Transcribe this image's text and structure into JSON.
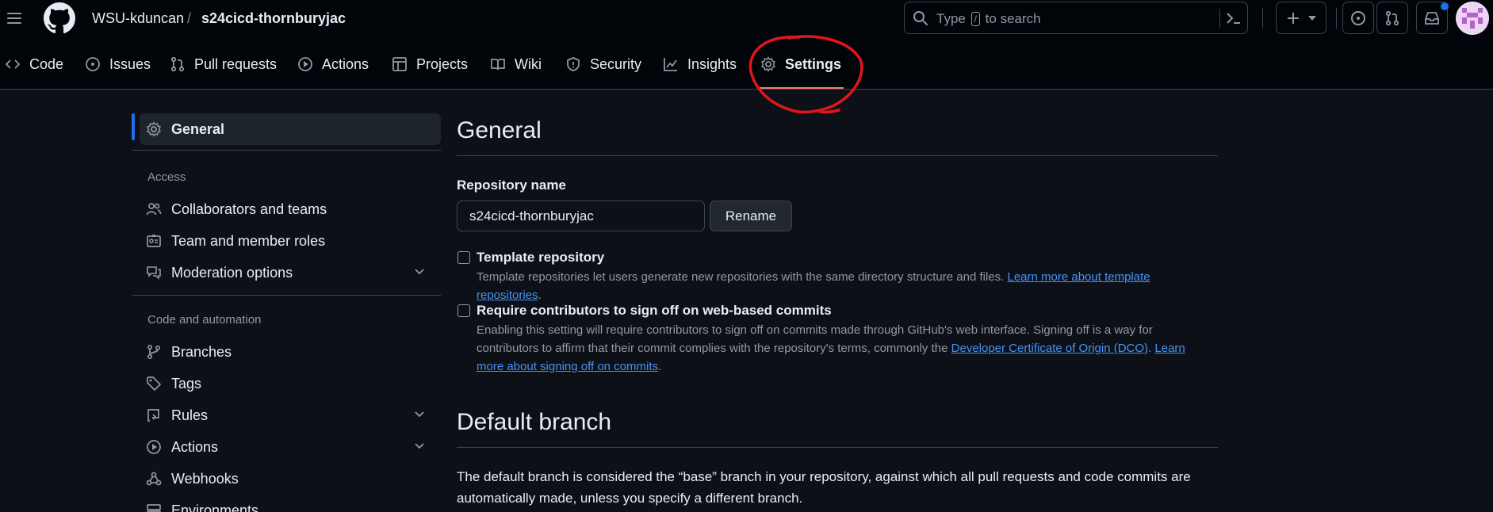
{
  "header": {
    "owner": "WSU-kduncan",
    "separator": "/",
    "repo": "s24cicd-thornburyjac",
    "search_prefix": "Type",
    "search_key": "/",
    "search_suffix": "to search"
  },
  "repo_nav": {
    "tabs": [
      {
        "label": "Code",
        "icon": "code-icon"
      },
      {
        "label": "Issues",
        "icon": "issue-icon"
      },
      {
        "label": "Pull requests",
        "icon": "pull-request-icon"
      },
      {
        "label": "Actions",
        "icon": "play-icon"
      },
      {
        "label": "Projects",
        "icon": "table-icon"
      },
      {
        "label": "Wiki",
        "icon": "book-icon"
      },
      {
        "label": "Security",
        "icon": "shield-icon"
      },
      {
        "label": "Insights",
        "icon": "graph-icon"
      },
      {
        "label": "Settings",
        "icon": "gear-icon",
        "selected": true
      }
    ]
  },
  "sidebar": {
    "general": "General",
    "access_heading": "Access",
    "access_items": [
      {
        "label": "Collaborators and teams",
        "icon": "people-icon"
      },
      {
        "label": "Team and member roles",
        "icon": "id-badge-icon"
      },
      {
        "label": "Moderation options",
        "icon": "comment-discussion-icon",
        "expandable": true
      }
    ],
    "code_heading": "Code and automation",
    "code_items": [
      {
        "label": "Branches",
        "icon": "branch-icon"
      },
      {
        "label": "Tags",
        "icon": "tag-icon"
      },
      {
        "label": "Rules",
        "icon": "repo-push-icon",
        "expandable": true
      },
      {
        "label": "Actions",
        "icon": "play-icon",
        "expandable": true
      },
      {
        "label": "Webhooks",
        "icon": "webhook-icon"
      },
      {
        "label": "Environments",
        "icon": "server-icon"
      }
    ]
  },
  "main": {
    "title": "General",
    "repo_name_label": "Repository name",
    "repo_name_value": "s24cicd-thornburyjac",
    "rename_label": "Rename",
    "template": {
      "label": "Template repository",
      "desc": "Template repositories let users generate new repositories with the same directory structure and files.",
      "link": "Learn more about template repositories",
      "after": "."
    },
    "signoff": {
      "label": "Require contributors to sign off on web-based commits",
      "desc_1": "Enabling this setting will require contributors to sign off on commits made through GitHub's web interface. Signing off is a way for contributors to affirm that their commit complies with the repository's terms, commonly the",
      "dco_link": "Developer Certificate of Origin (DCO)",
      "mid": ".",
      "learn_link": "Learn more about signing off on commits",
      "after": "."
    },
    "default_branch_title": "Default branch",
    "default_branch_desc": "The default branch is considered the “base” branch in your repository, against which all pull requests and code commits are automatically made, unless you specify a different branch."
  },
  "colors": {
    "accent": "#1f6feb",
    "tab_underline": "#f78166",
    "link": "#4493f8",
    "annotation": "#e0161c"
  }
}
